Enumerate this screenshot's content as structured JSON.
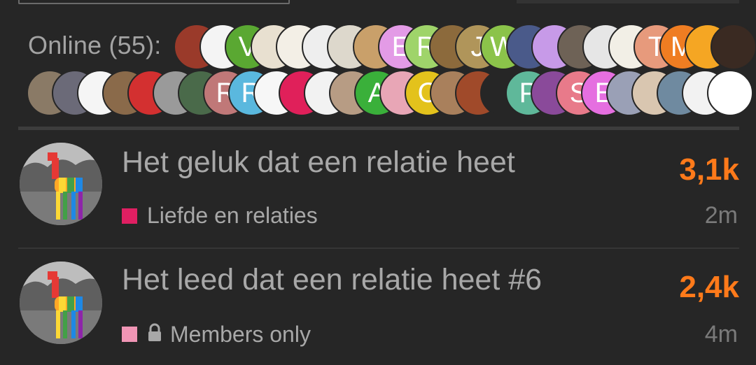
{
  "online": {
    "label": "Online (55):",
    "row1": [
      {
        "bg": "#9a3a2a",
        "letter": ""
      },
      {
        "bg": "#f4f4f4",
        "letter": ""
      },
      {
        "bg": "#5aa832",
        "letter": "V"
      },
      {
        "bg": "#e8e0d0",
        "letter": ""
      },
      {
        "bg": "#f3efe6",
        "letter": ""
      },
      {
        "bg": "#eeeeee",
        "letter": ""
      },
      {
        "bg": "#ddd8cc",
        "letter": ""
      },
      {
        "bg": "#c9a06a",
        "letter": ""
      },
      {
        "bg": "#e39be6",
        "letter": "E"
      },
      {
        "bg": "#9fd46a",
        "letter": "R"
      },
      {
        "bg": "#8c6a3c",
        "letter": ""
      },
      {
        "bg": "#b0955a",
        "letter": "J"
      },
      {
        "bg": "#8bc34a",
        "letter": "W"
      },
      {
        "bg": "#4a5a8a",
        "letter": ""
      },
      {
        "bg": "#c79ae8",
        "letter": ""
      },
      {
        "bg": "#6e6256",
        "letter": ""
      },
      {
        "bg": "#e6e6e6",
        "letter": ""
      },
      {
        "bg": "#f2efe6",
        "letter": ""
      },
      {
        "bg": "#e79a7c",
        "letter": "T"
      },
      {
        "bg": "#ef7d22",
        "letter": "M"
      },
      {
        "bg": "#f5a623",
        "letter": ""
      },
      {
        "bg": "#3a2a22",
        "letter": ""
      }
    ],
    "row2": [
      {
        "bg": "#8a7a66",
        "letter": ""
      },
      {
        "bg": "#6b6a78",
        "letter": ""
      },
      {
        "bg": "#f5f5f5",
        "letter": ""
      },
      {
        "bg": "#8a6a4a",
        "letter": ""
      },
      {
        "bg": "#d33030",
        "letter": ""
      },
      {
        "bg": "#9a9a9a",
        "letter": ""
      },
      {
        "bg": "#4a6a4a",
        "letter": ""
      },
      {
        "bg": "#c07878",
        "letter": "R"
      },
      {
        "bg": "#5ab8de",
        "letter": "R"
      },
      {
        "bg": "#f7f7f7",
        "letter": ""
      },
      {
        "bg": "#e0205a",
        "letter": ""
      },
      {
        "bg": "#f2f2f2",
        "letter": ""
      },
      {
        "bg": "#b79c84",
        "letter": ""
      },
      {
        "bg": "#3ab03a",
        "letter": "A"
      },
      {
        "bg": "#e8a6b6",
        "letter": ""
      },
      {
        "bg": "#e3c21c",
        "letter": "C"
      },
      {
        "bg": "#a9805c",
        "letter": ""
      },
      {
        "bg": "#a04a2a",
        "letter": ""
      },
      {
        "bg": "#262626",
        "letter": ""
      },
      {
        "bg": "#5fb89a",
        "letter": "P"
      },
      {
        "bg": "#8a4a9a",
        "letter": ""
      },
      {
        "bg": "#e87a8a",
        "letter": "S"
      },
      {
        "bg": "#e56fe0",
        "letter": "E"
      },
      {
        "bg": "#9aa0b6",
        "letter": ""
      },
      {
        "bg": "#d9c6b0",
        "letter": ""
      },
      {
        "bg": "#6f8aa0",
        "letter": ""
      },
      {
        "bg": "#f2f2f2",
        "letter": ""
      },
      {
        "bg": "#ffffff",
        "letter": ""
      }
    ]
  },
  "topics": [
    {
      "title": "Het geluk dat een relatie heet",
      "count": "3,1k",
      "category": "Liefde en relaties",
      "category_color": "#e01f62",
      "time": "2m",
      "locked": false
    },
    {
      "title": "Het leed dat een relatie heet #6",
      "count": "2,4k",
      "category": "Members only",
      "category_color": "#f095b5",
      "time": "4m",
      "locked": true
    }
  ],
  "icons": {
    "lock": "lock-icon",
    "llama": "rainbow-llama-avatar"
  },
  "colors": {
    "background": "#262626",
    "accent": "#ff7a1a",
    "text": "#a8a8a8",
    "muted": "#7a7a7a"
  }
}
